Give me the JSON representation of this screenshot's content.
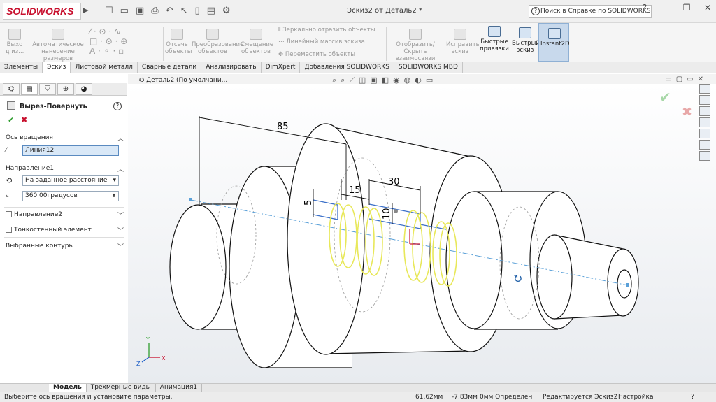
{
  "app": {
    "name": "SOLIDWORKS",
    "window_title": "Эскиз2 от Деталь2 *",
    "help_search_placeholder": "Поиск в Справке по SOLIDWORKS"
  },
  "ribbon": {
    "exit_sketch": "Выхо д из...",
    "auto_dimension": "Автоматическое нанесение размеров",
    "offset": "Отсечь объекты",
    "convert": "Преобразование объектов",
    "offset_entities": "Смещение объектов",
    "mirror": "Зеркально отразить объекты",
    "linear_pattern": "Линейный массив эскиза",
    "move": "Переместить объекты",
    "show_hide": "Отобразить/Скрыть взаимосвязи",
    "repair": "Исправить эскиз",
    "quick_snaps": "Быстрые привязки",
    "rapid_sketch": "Быстрый эскиз",
    "instant2d": "Instant2D"
  },
  "tabs": [
    "Элементы",
    "Эскиз",
    "Листовой металл",
    "Сварные детали",
    "Анализировать",
    "DimXpert",
    "Добавления SOLIDWORKS",
    "SOLIDWORKS MBD"
  ],
  "active_tab": "Эскиз",
  "panel": {
    "feature_title": "Вырез-Повернуть",
    "axis_section": "Ось вращения",
    "axis_value": "Линия12",
    "dir1_section": "Направление1",
    "dir1_type": "На заданное расстояние",
    "dir1_angle": "360.00градусов",
    "dir2_label": "Направление2",
    "thin_label": "Тонкостенный элемент",
    "contours_section": "Выбранные контуры"
  },
  "viewport": {
    "tree_root": "Деталь2 (По умолчани...",
    "dims": {
      "d85": "85",
      "d30": "30",
      "d15": "15",
      "d5": "5",
      "d10": "10"
    },
    "axis_labels": {
      "x": "X",
      "y": "Y",
      "z": "Z"
    }
  },
  "bottom_tabs": [
    "Модель",
    "Трехмерные виды",
    "Анимация1"
  ],
  "status": {
    "message": "Выберите ось вращения и установите параметры.",
    "x": "61.62мм",
    "y": "-7.83мм",
    "z": "0мм Определен",
    "editing": "Редактируется Эскиз2",
    "settings": "Настройка"
  },
  "colors": {
    "sketch_yellow": "#e8e85a",
    "axis_blue": "#5aa0d8",
    "brand_red": "#c8102e",
    "instant_bg": "#c8d9ec"
  }
}
